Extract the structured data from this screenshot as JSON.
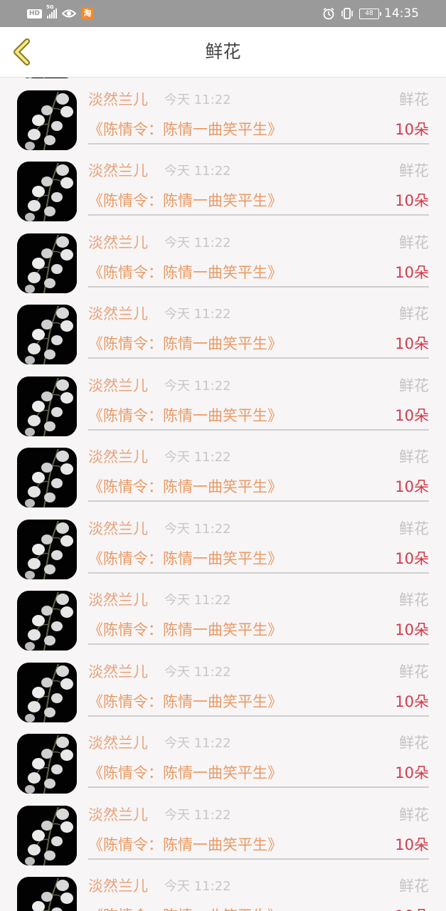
{
  "status_bar": {
    "hd": "HD",
    "network": "5G",
    "app_badge": "淘",
    "battery": "48",
    "time": "14:35"
  },
  "header": {
    "title": "鲜花"
  },
  "items": [
    {
      "user": "淡然兰儿",
      "time": "今天 11:22",
      "type": "鲜花",
      "book": "《陈情令：陈情一曲笑平生》",
      "count": "10朵"
    },
    {
      "user": "淡然兰儿",
      "time": "今天 11:22",
      "type": "鲜花",
      "book": "《陈情令：陈情一曲笑平生》",
      "count": "10朵"
    },
    {
      "user": "淡然兰儿",
      "time": "今天 11:22",
      "type": "鲜花",
      "book": "《陈情令：陈情一曲笑平生》",
      "count": "10朵"
    },
    {
      "user": "淡然兰儿",
      "time": "今天 11:22",
      "type": "鲜花",
      "book": "《陈情令：陈情一曲笑平生》",
      "count": "10朵"
    },
    {
      "user": "淡然兰儿",
      "time": "今天 11:22",
      "type": "鲜花",
      "book": "《陈情令：陈情一曲笑平生》",
      "count": "10朵"
    },
    {
      "user": "淡然兰儿",
      "time": "今天 11:22",
      "type": "鲜花",
      "book": "《陈情令：陈情一曲笑平生》",
      "count": "10朵"
    },
    {
      "user": "淡然兰儿",
      "time": "今天 11:22",
      "type": "鲜花",
      "book": "《陈情令：陈情一曲笑平生》",
      "count": "10朵"
    },
    {
      "user": "淡然兰儿",
      "time": "今天 11:22",
      "type": "鲜花",
      "book": "《陈情令：陈情一曲笑平生》",
      "count": "10朵"
    },
    {
      "user": "淡然兰儿",
      "time": "今天 11:22",
      "type": "鲜花",
      "book": "《陈情令：陈情一曲笑平生》",
      "count": "10朵"
    },
    {
      "user": "淡然兰儿",
      "time": "今天 11:22",
      "type": "鲜花",
      "book": "《陈情令：陈情一曲笑平生》",
      "count": "10朵"
    },
    {
      "user": "淡然兰儿",
      "time": "今天 11:22",
      "type": "鲜花",
      "book": "《陈情令：陈情一曲笑平生》",
      "count": "10朵"
    },
    {
      "user": "淡然兰儿",
      "time": "今天 11:22",
      "type": "鲜花",
      "book": "《陈情令：陈情一曲笑平生》",
      "count": "10朵"
    },
    {
      "user": "淡然兰儿",
      "time": "今天 11:22",
      "type": "鲜花",
      "book": "《陈情令：陈情一曲笑平生》",
      "count": "10朵"
    }
  ]
}
